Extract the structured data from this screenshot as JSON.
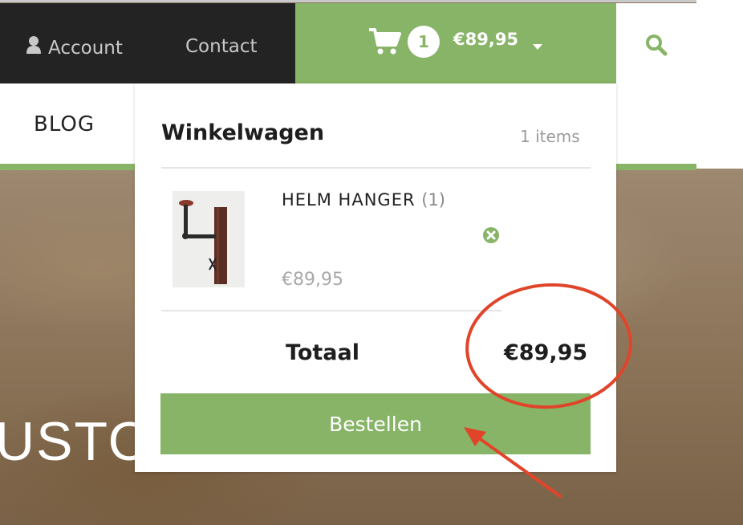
{
  "topbar": {
    "account_label": "Account",
    "contact_label": "Contact"
  },
  "cart": {
    "count": "1",
    "total": "€89,95"
  },
  "nav": {
    "blog_label": "BLOG"
  },
  "hero": {
    "text": "USTO"
  },
  "dropdown": {
    "title": "Winkelwagen",
    "items_count": "1 items",
    "items": [
      {
        "name": "HELM HANGER",
        "qty": "(1)",
        "price": "€89,95"
      }
    ],
    "total_label": "Totaal",
    "total_value": "€89,95",
    "checkout_label": "Bestellen"
  },
  "colors": {
    "brand_green": "#88b467",
    "dark_bar": "#232323",
    "annotation_red": "#e0452a"
  },
  "icons": {
    "account": "user-icon",
    "cart": "shopping-cart-icon",
    "caret": "caret-down-icon",
    "search": "search-icon",
    "remove": "remove-circle-icon"
  }
}
